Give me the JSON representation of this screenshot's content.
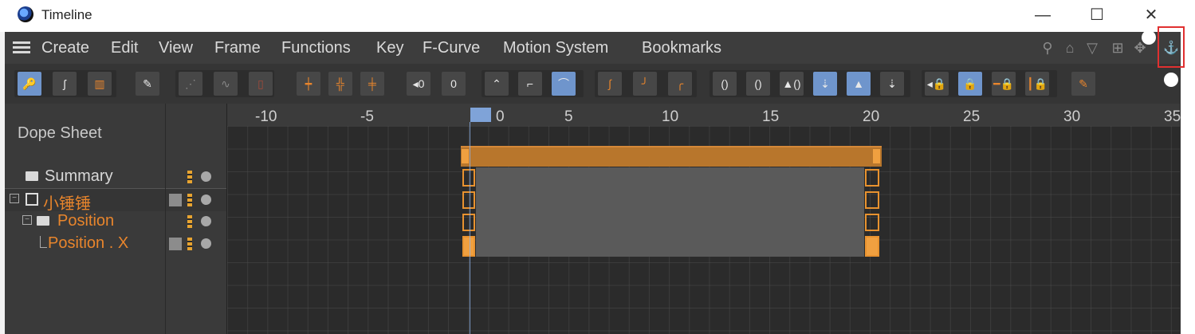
{
  "window": {
    "title": "Timeline",
    "controls": [
      "—",
      "☐",
      "✕"
    ]
  },
  "menu": {
    "items": [
      "Create",
      "Edit",
      "View",
      "Frame",
      "Functions",
      "Key",
      "F-Curve",
      "Motion System",
      "Bookmarks"
    ],
    "right_icons": [
      "search-icon",
      "home-icon",
      "filter-icon",
      "add-panel-icon",
      "snap-icon",
      "anchor-icon"
    ]
  },
  "toolbar": {
    "groups": [
      [
        "dope-sheet-mode-icon",
        "f-curve-mode-icon",
        "motion-mode-icon"
      ],
      [
        "record-key-icon"
      ],
      [
        "ripple-edit-icon",
        "waveform-icon",
        "clip-icon"
      ],
      [
        "add-key-icon",
        "add-keys-icon",
        "delete-keys-icon"
      ],
      [
        "key-zero-left-icon",
        "key-zero-icon"
      ],
      [
        "linear-icon",
        "step-icon",
        "spline-icon"
      ],
      [
        "ease-in-out-icon",
        "ease-out-icon",
        "ease-in-icon"
      ],
      [
        "clamp-key-icon",
        "overshoot-icon",
        "weighted-icon",
        "auto-tangent-icon",
        "remove-overshoot-icon",
        "flat-tangent-icon"
      ],
      [
        "lock-value-icon",
        "lock-time-icon",
        "lock-angle-icon",
        "lock-length-icon"
      ],
      [
        "break-tangent-icon"
      ]
    ],
    "accent": "#e8852c",
    "active_color": "#6f95cc"
  },
  "dope_sheet": {
    "title": "Dope Sheet",
    "tracks": [
      {
        "label": "Summary",
        "color": "#d9d9d9"
      },
      {
        "label": "小锤锤",
        "color": "#e8852c"
      },
      {
        "label": "Position",
        "color": "#e8852c"
      },
      {
        "label": "Position . X",
        "color": "#e8852c"
      }
    ]
  },
  "ruler": {
    "ticks": [
      "-10",
      "-5",
      "0",
      "5",
      "10",
      "15",
      "20",
      "25",
      "30",
      "35"
    ]
  },
  "timeline": {
    "current_frame": 0,
    "key_start_frame": 0,
    "key_end_frame": 20
  }
}
